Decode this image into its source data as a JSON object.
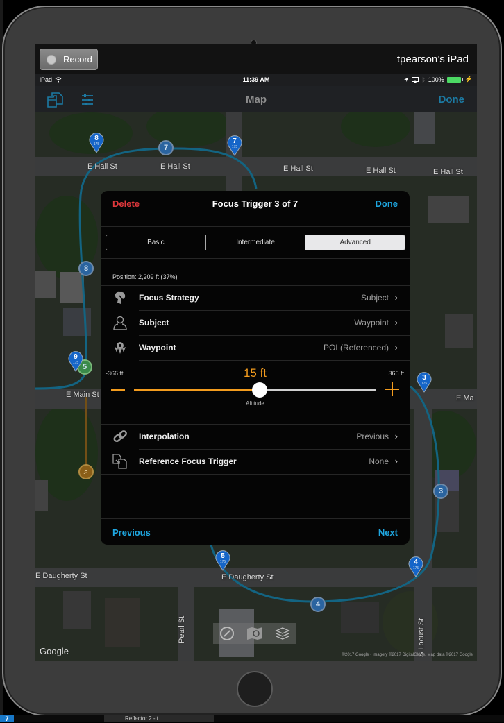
{
  "recorder": {
    "record_label": "Record",
    "device_name": "tpearson’s iPad"
  },
  "status_bar": {
    "carrier": "iPad",
    "time": "11:39 AM",
    "battery": "100%"
  },
  "nav": {
    "title": "Map",
    "done_label": "Done",
    "left_icons": [
      "folder-icon",
      "sliders-icon"
    ]
  },
  "map": {
    "street_labels": [
      "E Hall St",
      "E Hall St",
      "E Hall St",
      "E Hall St",
      "E Hall St",
      "E Main St",
      "E Ma",
      "S Locust St",
      "E Daugherty St",
      "E Daugherty St",
      "Pearl St",
      "S Locust St"
    ],
    "waypoint_pins": [
      {
        "number": "8",
        "altitude": "175"
      },
      {
        "number": "7",
        "altitude": "175"
      },
      {
        "number": "9",
        "altitude": "175"
      },
      {
        "number": "3",
        "altitude": "175"
      },
      {
        "number": "5",
        "altitude": "175"
      },
      {
        "number": "4",
        "altitude": "175"
      }
    ],
    "focus_markers": [
      "7",
      "8",
      "3",
      "4"
    ],
    "poi_marker": "5",
    "google_logo": "Google",
    "attribution": "©2017 Google · Imagery ©2017 DigitalGlobe, Map data ©2017 Google",
    "controls": [
      "compass-icon",
      "map-search-icon",
      "layers-icon"
    ],
    "accent_path_color": "#1e9ac8",
    "focus_path_color": "#d08a1e"
  },
  "panel": {
    "delete_label": "Delete",
    "title": "Focus Trigger 3 of 7",
    "done_label": "Done",
    "tabs": [
      {
        "label": "Basic",
        "active": false
      },
      {
        "label": "Intermediate",
        "active": false
      },
      {
        "label": "Advanced",
        "active": true
      }
    ],
    "position": "Position: 2,209 ft (37%)",
    "rows_top": [
      {
        "label": "Focus Strategy",
        "value": "Subject",
        "icon": "focus-strategy-icon"
      },
      {
        "label": "Subject",
        "value": "Waypoint",
        "icon": "person-icon"
      },
      {
        "label": "Waypoint",
        "value": "POI (Referenced)",
        "icon": "waypoint-icon"
      }
    ],
    "slider": {
      "min_label": "-366 ft",
      "max_label": "366 ft",
      "value_label": "15 ft",
      "caption": "Altitude",
      "min": -366,
      "max": 366,
      "value": 15
    },
    "rows_bottom": [
      {
        "label": "Interpolation",
        "value": "Previous",
        "icon": "link-icon"
      },
      {
        "label": "Reference Focus Trigger",
        "value": "None",
        "icon": "reference-icon"
      }
    ],
    "previous_label": "Previous",
    "next_label": "Next",
    "colors": {
      "delete": "#e0383c",
      "accent": "#1ea6e0",
      "slider": "#f39c1e"
    }
  },
  "taskbar": {
    "start_label": "7",
    "item_label": "Reflector 2 - t..."
  }
}
